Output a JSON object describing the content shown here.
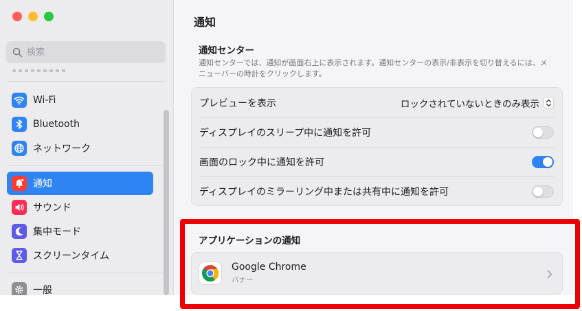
{
  "window": {
    "title": "通知"
  },
  "sidebar": {
    "search_placeholder": "検索",
    "items": [
      {
        "label": "Wi-Fi",
        "icon": "wifi-icon",
        "color": "#2f84f3"
      },
      {
        "label": "Bluetooth",
        "icon": "bluetooth-icon",
        "color": "#2f84f3"
      },
      {
        "label": "ネットワーク",
        "icon": "globe-icon",
        "color": "#2f84f3"
      },
      {
        "label": "通知",
        "icon": "bell-icon",
        "color": "#ff3b30",
        "active": true
      },
      {
        "label": "サウンド",
        "icon": "speaker-icon",
        "color": "#ff2d55"
      },
      {
        "label": "集中モード",
        "icon": "moon-icon",
        "color": "#5e5ce6"
      },
      {
        "label": "スクリーンタイム",
        "icon": "hourglass-icon",
        "color": "#5e5ce6"
      },
      {
        "label": "一般",
        "icon": "gear-icon",
        "color": "#8e8e93"
      }
    ]
  },
  "notification_center": {
    "title": "通知センター",
    "description": "通知センターでは、通知が画面右上に表示されます。通知センターの表示/非表示を切り替えるには、メニューバーの時計をクリックします。"
  },
  "settings": [
    {
      "label": "プレビューを表示",
      "type": "popup",
      "value": "ロックされていないときのみ表示"
    },
    {
      "label": "ディスプレイのスリープ中に通知を許可",
      "type": "toggle",
      "on": false
    },
    {
      "label": "画面のロック中に通知を許可",
      "type": "toggle",
      "on": true
    },
    {
      "label": "ディスプレイのミラーリング中または共有中に通知を許可",
      "type": "toggle",
      "on": false
    }
  ],
  "app_notifications": {
    "title": "アプリケーションの通知",
    "apps": [
      {
        "name": "Google Chrome",
        "subtitle": "バナー",
        "icon": "chrome-icon"
      }
    ]
  },
  "colors": {
    "accent": "#2f84f3",
    "highlight_border": "#ec0000"
  }
}
